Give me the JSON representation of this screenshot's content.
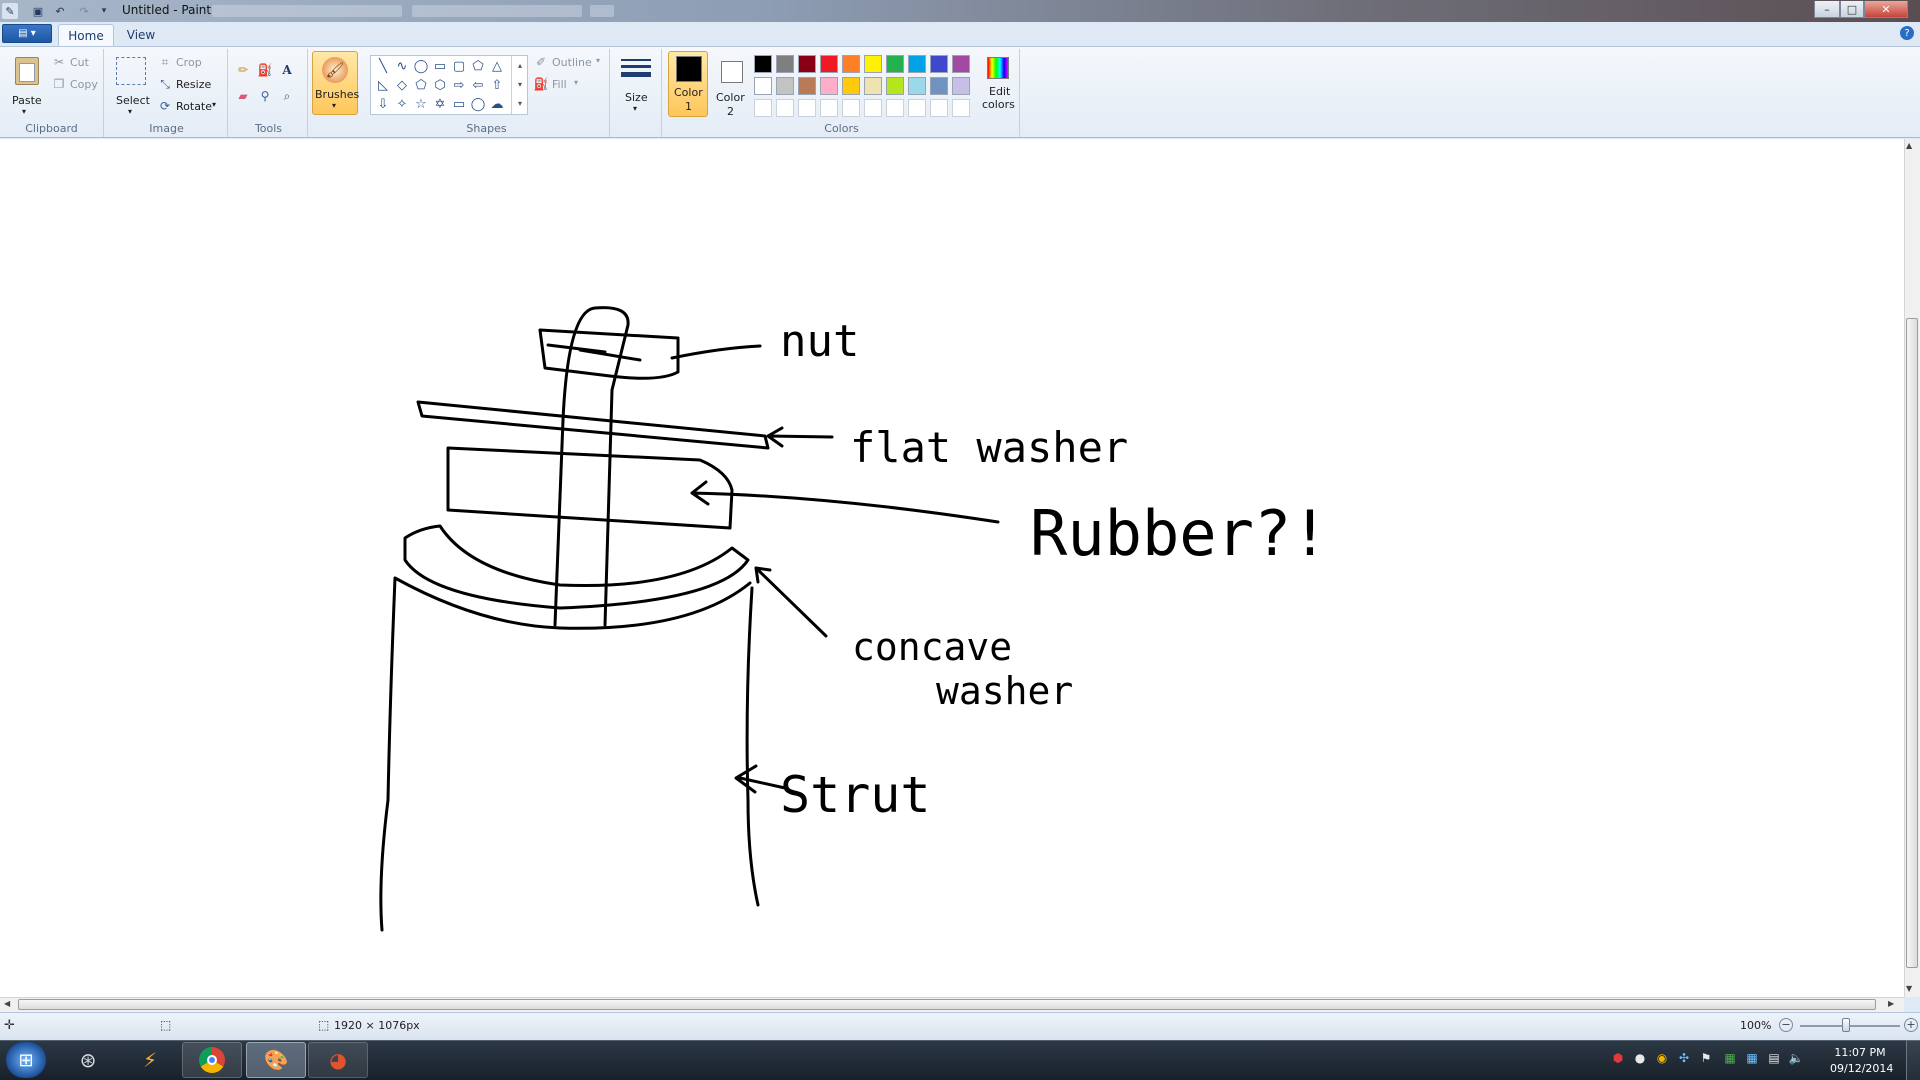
{
  "window": {
    "title": "Untitled - Paint",
    "minimize": "–",
    "maximize": "□",
    "close": "✕"
  },
  "quick_access": {
    "menu_icon": "paint-menu-icon",
    "save_icon": "save-icon",
    "undo_icon": "undo-icon",
    "redo_icon": "redo-icon",
    "customize_icon": "dropdown-icon"
  },
  "tabs": {
    "file": "▤ ▾",
    "home": "Home",
    "view": "View",
    "help": "?"
  },
  "ribbon": {
    "clipboard": {
      "label": "Clipboard",
      "paste": "Paste",
      "cut": "Cut",
      "copy": "Copy"
    },
    "image": {
      "label": "Image",
      "select": "Select",
      "crop": "Crop",
      "resize": "Resize",
      "rotate": "Rotate"
    },
    "tools": {
      "label": "Tools"
    },
    "brushes": {
      "label": "Brushes"
    },
    "shapes": {
      "label": "Shapes",
      "outline": "Outline",
      "fill": "Fill"
    },
    "size": {
      "label": "Size"
    },
    "colors": {
      "label": "Colors",
      "color1_line1": "Color",
      "color1_line2": "1",
      "color2_line1": "Color",
      "color2_line2": "2",
      "color1_value": "#000000",
      "color2_value": "#ffffff",
      "edit_line1": "Edit",
      "edit_line2": "colors",
      "palette_row1": [
        "#000000",
        "#7f7f7f",
        "#880015",
        "#ed1c24",
        "#ff7f27",
        "#fff200",
        "#22b14c",
        "#00a2e8",
        "#3f48cc",
        "#a349a4"
      ],
      "palette_row2": [
        "#ffffff",
        "#c3c3c3",
        "#b97a57",
        "#ffaec9",
        "#ffc90e",
        "#efe4b0",
        "#b5e61d",
        "#99d9ea",
        "#7092be",
        "#c8bfe7"
      ],
      "palette_row3": [
        "#ffffff",
        "#ffffff",
        "#ffffff",
        "#ffffff",
        "#ffffff",
        "#ffffff",
        "#ffffff",
        "#ffffff",
        "#ffffff",
        "#ffffff"
      ]
    }
  },
  "drawing": {
    "label_nut": "nut",
    "label_flat_washer": "flat washer",
    "label_rubber": "Rubber?!",
    "label_concave_line1": "concave",
    "label_concave_line2": "washer",
    "label_strut": "Strut"
  },
  "status": {
    "dimensions": "1920 × 1076px",
    "zoom": "100%"
  },
  "taskbar": {
    "clock_time": "11:07 PM",
    "clock_date": "09/12/2014"
  }
}
